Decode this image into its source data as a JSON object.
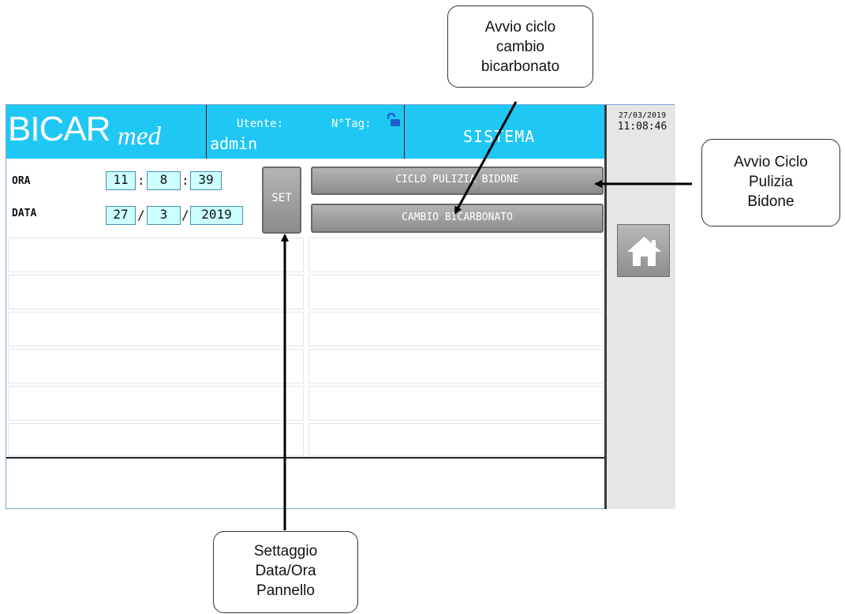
{
  "header": {
    "logo_main": "BICAR",
    "logo_sub": "med",
    "user_label": "Utente:",
    "user_name": "admin",
    "tag_label": "N°Tag:",
    "title": "SISTEMA"
  },
  "clock": {
    "date": "27/03/2019",
    "time": "11:08:46"
  },
  "settings": {
    "time_label": "ORA",
    "hour": "11",
    "minute": "8",
    "second": "39",
    "time_sep": ":",
    "date_label": "DATA",
    "day": "27",
    "month": "3",
    "year": "2019",
    "date_sep": "/",
    "set_label": "SET"
  },
  "buttons": {
    "cleaning": "CICLO PULIZIA BIDONE",
    "bicarbonate": "CAMBIO BICARBONATO"
  },
  "callouts": {
    "cambio": [
      "Avvio ciclo",
      "cambio",
      "bicarbonato"
    ],
    "pulizia": [
      "Avvio Ciclo",
      "Pulizia",
      "Bidone"
    ],
    "settaggio": [
      "Settaggio",
      "Data/Ora",
      "Pannello"
    ]
  },
  "colors": {
    "header": "#1fc7f5",
    "field": "#ccffff",
    "button": "#9a9a9a"
  },
  "icons": [
    "lock-open-icon",
    "home-icon"
  ]
}
